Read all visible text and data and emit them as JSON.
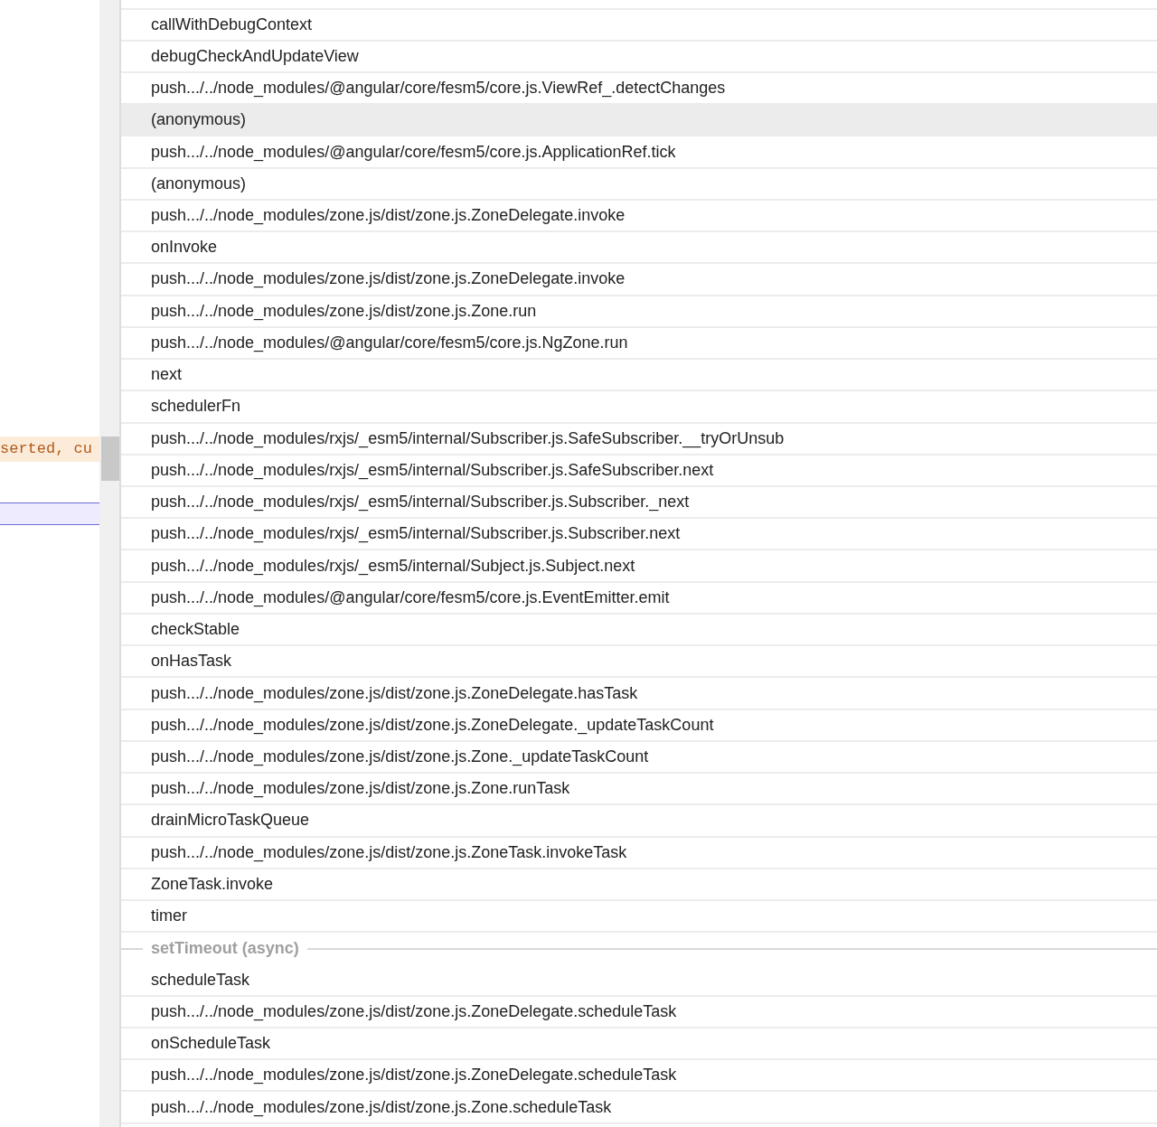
{
  "editor": {
    "lines": [
      {
        "text": "serted, cu",
        "kind": "warning"
      },
      {
        "kind": "highlight"
      }
    ]
  },
  "call_stack": {
    "frames": [
      {
        "kind": "frame",
        "name": "callWithDebugContext",
        "selected": false
      },
      {
        "kind": "frame",
        "name": "debugCheckAndUpdateView",
        "selected": false
      },
      {
        "kind": "frame",
        "name": "push.../../node_modules/@angular/core/fesm5/core.js.ViewRef_.detectChanges",
        "selected": false
      },
      {
        "kind": "frame",
        "name": "(anonymous)",
        "selected": true
      },
      {
        "kind": "frame",
        "name": "push.../../node_modules/@angular/core/fesm5/core.js.ApplicationRef.tick",
        "selected": false
      },
      {
        "kind": "frame",
        "name": "(anonymous)",
        "selected": false
      },
      {
        "kind": "frame",
        "name": "push.../../node_modules/zone.js/dist/zone.js.ZoneDelegate.invoke",
        "selected": false
      },
      {
        "kind": "frame",
        "name": "onInvoke",
        "selected": false
      },
      {
        "kind": "frame",
        "name": "push.../../node_modules/zone.js/dist/zone.js.ZoneDelegate.invoke",
        "selected": false
      },
      {
        "kind": "frame",
        "name": "push.../../node_modules/zone.js/dist/zone.js.Zone.run",
        "selected": false
      },
      {
        "kind": "frame",
        "name": "push.../../node_modules/@angular/core/fesm5/core.js.NgZone.run",
        "selected": false
      },
      {
        "kind": "frame",
        "name": "next",
        "selected": false
      },
      {
        "kind": "frame",
        "name": "schedulerFn",
        "selected": false
      },
      {
        "kind": "frame",
        "name": "push.../../node_modules/rxjs/_esm5/internal/Subscriber.js.SafeSubscriber.__tryOrUnsub",
        "selected": false
      },
      {
        "kind": "frame",
        "name": "push.../../node_modules/rxjs/_esm5/internal/Subscriber.js.SafeSubscriber.next",
        "selected": false
      },
      {
        "kind": "frame",
        "name": "push.../../node_modules/rxjs/_esm5/internal/Subscriber.js.Subscriber._next",
        "selected": false
      },
      {
        "kind": "frame",
        "name": "push.../../node_modules/rxjs/_esm5/internal/Subscriber.js.Subscriber.next",
        "selected": false
      },
      {
        "kind": "frame",
        "name": "push.../../node_modules/rxjs/_esm5/internal/Subject.js.Subject.next",
        "selected": false
      },
      {
        "kind": "frame",
        "name": "push.../../node_modules/@angular/core/fesm5/core.js.EventEmitter.emit",
        "selected": false
      },
      {
        "kind": "frame",
        "name": "checkStable",
        "selected": false
      },
      {
        "kind": "frame",
        "name": "onHasTask",
        "selected": false
      },
      {
        "kind": "frame",
        "name": "push.../../node_modules/zone.js/dist/zone.js.ZoneDelegate.hasTask",
        "selected": false
      },
      {
        "kind": "frame",
        "name": "push.../../node_modules/zone.js/dist/zone.js.ZoneDelegate._updateTaskCount",
        "selected": false
      },
      {
        "kind": "frame",
        "name": "push.../../node_modules/zone.js/dist/zone.js.Zone._updateTaskCount",
        "selected": false
      },
      {
        "kind": "frame",
        "name": "push.../../node_modules/zone.js/dist/zone.js.Zone.runTask",
        "selected": false
      },
      {
        "kind": "frame",
        "name": "drainMicroTaskQueue",
        "selected": false
      },
      {
        "kind": "frame",
        "name": "push.../../node_modules/zone.js/dist/zone.js.ZoneTask.invokeTask",
        "selected": false
      },
      {
        "kind": "frame",
        "name": "ZoneTask.invoke",
        "selected": false
      },
      {
        "kind": "frame",
        "name": "timer",
        "selected": false
      },
      {
        "kind": "async",
        "name": "setTimeout (async)"
      },
      {
        "kind": "frame",
        "name": "scheduleTask",
        "selected": false
      },
      {
        "kind": "frame",
        "name": "push.../../node_modules/zone.js/dist/zone.js.ZoneDelegate.scheduleTask",
        "selected": false
      },
      {
        "kind": "frame",
        "name": "onScheduleTask",
        "selected": false
      },
      {
        "kind": "frame",
        "name": "push.../../node_modules/zone.js/dist/zone.js.ZoneDelegate.scheduleTask",
        "selected": false
      },
      {
        "kind": "frame",
        "name": "push.../../node_modules/zone.js/dist/zone.js.Zone.scheduleTask",
        "selected": false
      }
    ]
  }
}
